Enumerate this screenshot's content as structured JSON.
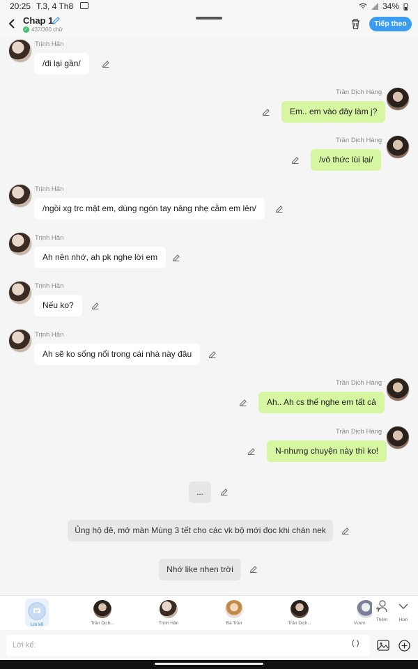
{
  "status": {
    "time": "20:25",
    "date": "T.3, 4 Th8",
    "battery": "34%"
  },
  "header": {
    "title": "Chap 1",
    "wordcount": "437/300 chữ",
    "next_label": "Tiếp theo"
  },
  "messages": [
    {
      "side": "left",
      "sender": "Trịnh Hân",
      "text": "/đi lại gần/"
    },
    {
      "side": "right",
      "sender": "Trần Dịch Hàng",
      "text": "Em.. em vào đây làm j?"
    },
    {
      "side": "right",
      "sender": "Trần Dịch Hàng",
      "text": "/vô thức lùi lại/"
    },
    {
      "side": "left",
      "sender": "Trịnh Hân",
      "text": "/ngồi xg trc mặt em, dùng ngón tay nâng nhẹ cằm em lên/"
    },
    {
      "side": "left",
      "sender": "Trịnh Hân",
      "text": "Ah nên nhớ, ah pk nghe lời em"
    },
    {
      "side": "left",
      "sender": "Trịnh Hân",
      "text": "Nếu ko?"
    },
    {
      "side": "left",
      "sender": "Trịnh Hân",
      "text": "Ah sẽ ko sống nổi trong cái nhà này đâu"
    },
    {
      "side": "right",
      "sender": "Trần Dịch Hàng",
      "text": "Ah.. Ah cs thế nghe em tất cả"
    },
    {
      "side": "right",
      "sender": "Trần Dịch Hàng",
      "text": "N-nhưng chuyện này thì ko!"
    }
  ],
  "narrations": [
    "...",
    "Ủng hộ đê, mở màn Mùng 3 tết cho các vk bộ mới đọc khi chán nek",
    "Nhớ like nhen trời"
  ],
  "characters": [
    {
      "label": "Lời kể"
    },
    {
      "label": "Trần Dịch..."
    },
    {
      "label": "Trịnh Hân"
    },
    {
      "label": "Bà Trần"
    },
    {
      "label": "Trần Dịch..."
    },
    {
      "label": "Vươn"
    }
  ],
  "actions": {
    "more_label": "Thêm",
    "collapse_label": "Hơn"
  },
  "input": {
    "placeholder": "Lời kể:",
    "paren": "( )"
  },
  "colors": {
    "accent": "#3b9cf2",
    "right_bubble": "#d7f6a1",
    "left_bubble": "#ffffff"
  }
}
